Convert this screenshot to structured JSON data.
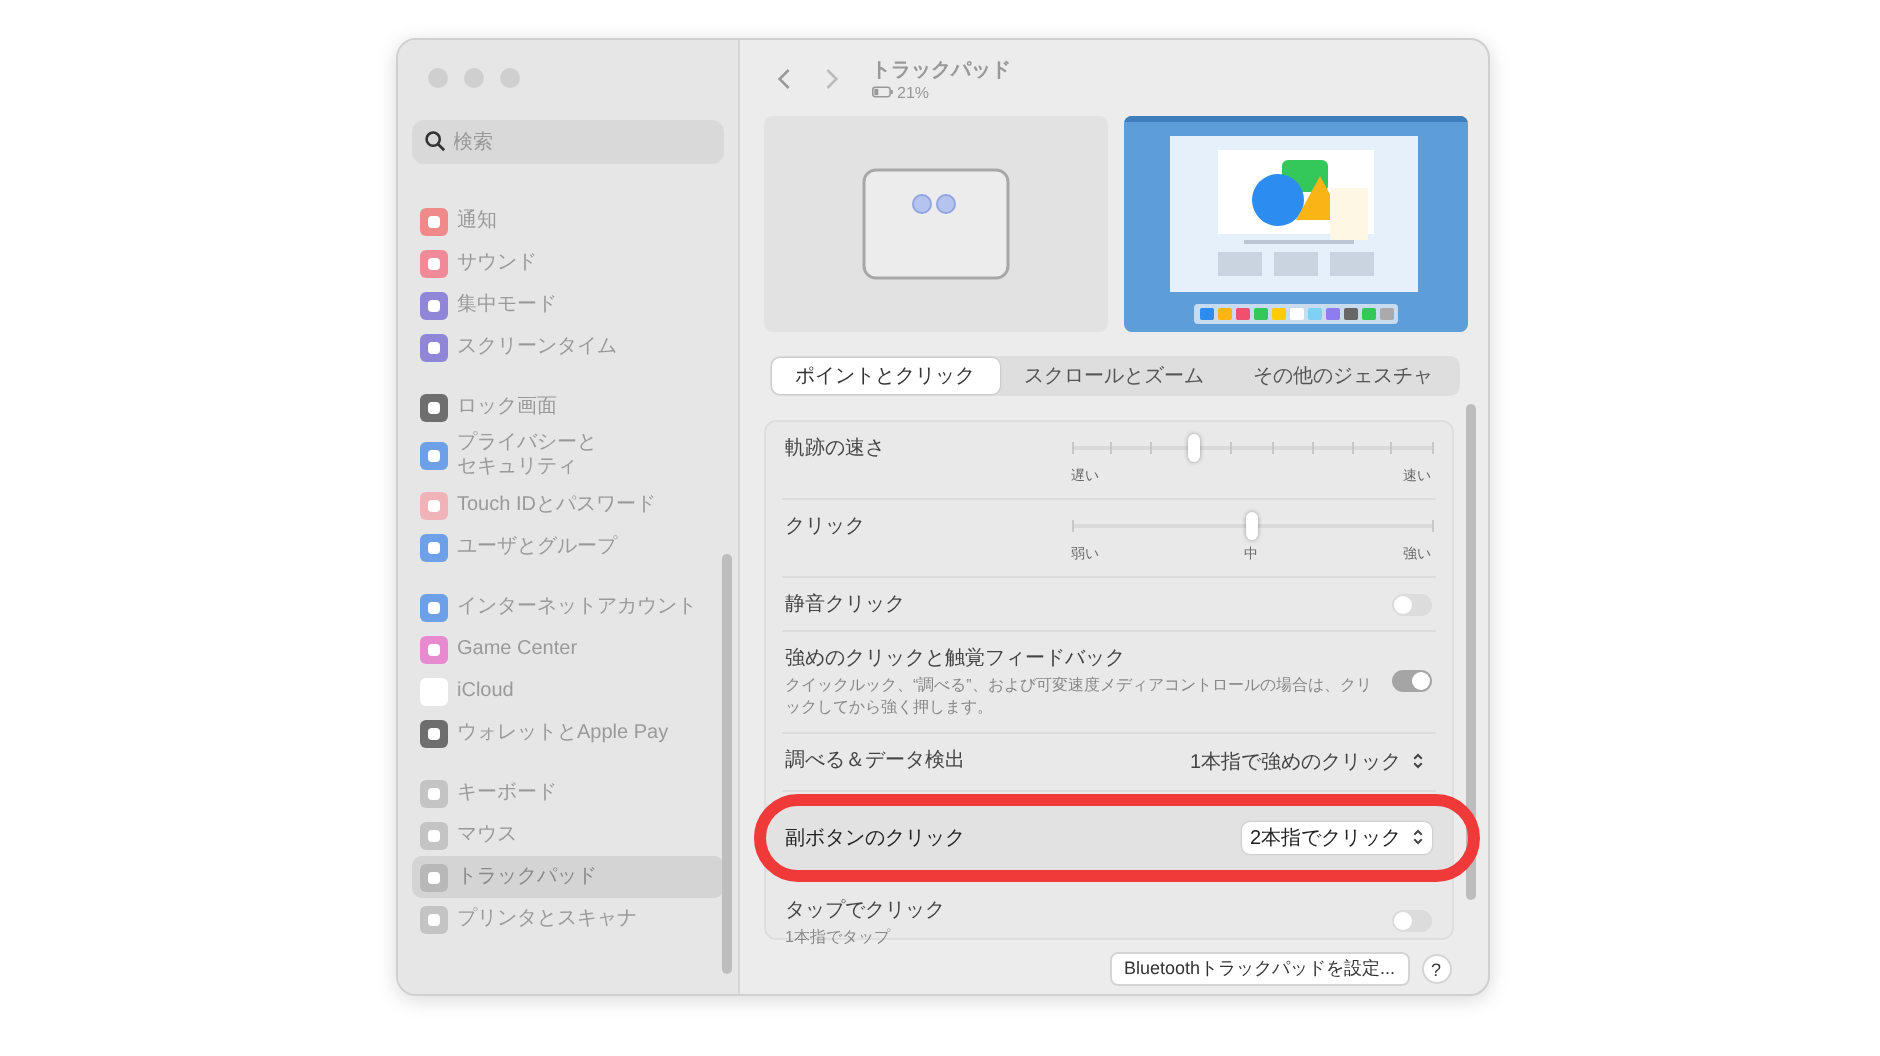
{
  "sidebar": {
    "search": {
      "placeholder": "検索"
    },
    "groups": [
      [
        {
          "label": "通知",
          "color": "#f08a8a",
          "selected": false
        },
        {
          "label": "サウンド",
          "color": "#f08a96",
          "selected": false
        },
        {
          "label": "集中モード",
          "color": "#8f86d8",
          "selected": false
        },
        {
          "label": "スクリーンタイム",
          "color": "#8f86d8",
          "selected": false
        }
      ],
      [
        {
          "label": "ロック画面",
          "color": "#6e6e6e",
          "selected": false
        },
        {
          "label": "プライバシーと",
          "continuation": "セキュリティ",
          "color": "#6ea0e8",
          "selected": false
        },
        {
          "label": "Touch IDとパスワード",
          "color": "#f0b4b8",
          "selected": false
        },
        {
          "label": "ユーザとグループ",
          "color": "#6ea0e8",
          "selected": false
        }
      ],
      [
        {
          "label": "インターネットアカウント",
          "color": "#6ea0e8",
          "selected": false
        },
        {
          "label": "Game Center",
          "color": "#e88ad0",
          "selected": false
        },
        {
          "label": "iCloud",
          "color": "#ffffff",
          "selected": false
        },
        {
          "label": "ウォレットとApple Pay",
          "color": "#6e6e6e",
          "selected": false
        }
      ],
      [
        {
          "label": "キーボード",
          "color": "#c4c4c4",
          "selected": false
        },
        {
          "label": "マウス",
          "color": "#c4c4c4",
          "selected": false
        },
        {
          "label": "トラックパッド",
          "color": "#b8b8b8",
          "selected": true
        },
        {
          "label": "プリンタとスキャナ",
          "color": "#c4c4c4",
          "selected": false
        }
      ]
    ]
  },
  "header": {
    "title": "トラックパッド",
    "battery": "21%"
  },
  "tabs": [
    {
      "label": "ポイントとクリック",
      "selected": true
    },
    {
      "label": "スクロールとズーム",
      "selected": false
    },
    {
      "label": "その他のジェスチャ",
      "selected": false
    }
  ],
  "settings": [
    {
      "kind": "slider",
      "label": "軌跡の速さ",
      "level": 0.34,
      "scale": [
        "遅い",
        "速い"
      ]
    },
    {
      "kind": "slider",
      "label": "クリック",
      "level": 0.5,
      "scale": [
        "弱い",
        "中",
        "強い"
      ]
    },
    {
      "kind": "toggle",
      "label": "静音クリック",
      "on": false
    },
    {
      "kind": "toggle",
      "label": "強めのクリックと触覚フィードバック",
      "description": "クイックルック、“調べる”、および可変速度メディアコントロールの場合は、クリックしてから強く押します。",
      "on": true
    },
    {
      "kind": "popup",
      "label": "調べる＆データ検出",
      "value": "1本指で強めのクリック",
      "highlighted": false
    },
    {
      "kind": "popup",
      "label": "副ボタンのクリック",
      "value": "2本指でクリック",
      "highlighted": true
    },
    {
      "kind": "toggle",
      "label": "タップでクリック",
      "description": "1本指でタップ",
      "on": false
    }
  ],
  "footer": {
    "button": "Bluetoothトラックパッドを設定...",
    "help": "?"
  }
}
